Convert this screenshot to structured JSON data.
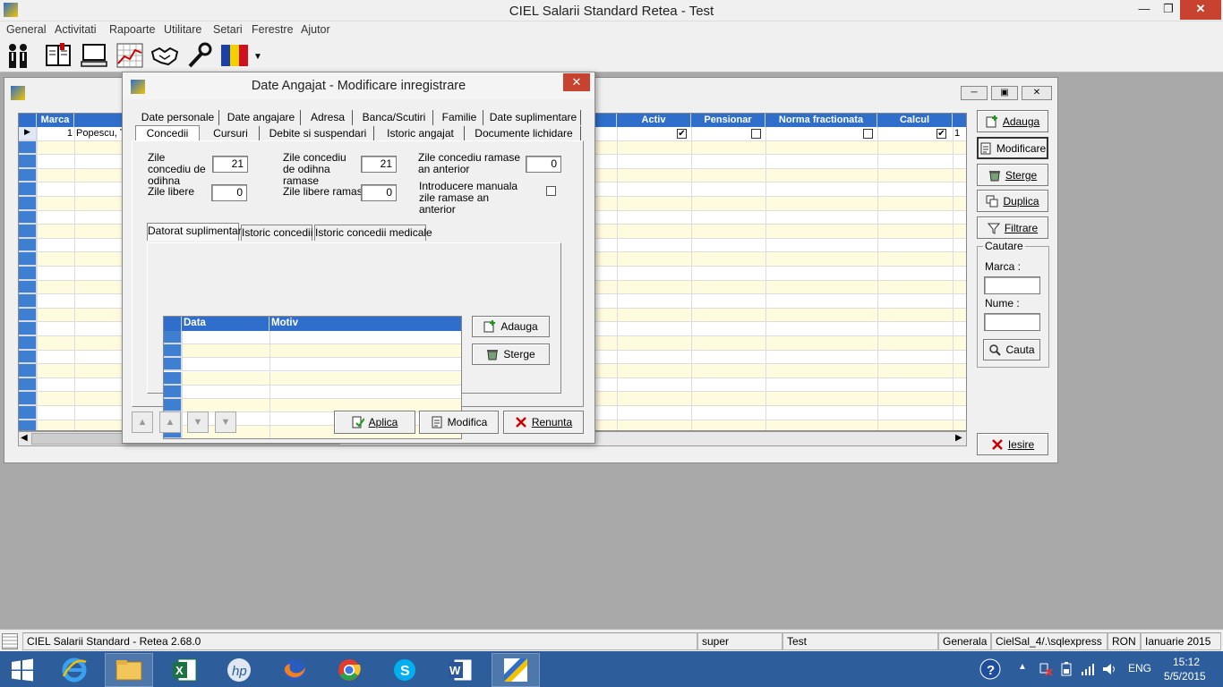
{
  "app": {
    "title": "CIEL Salarii Standard Retea - Test"
  },
  "menu": [
    "General",
    "Activitati",
    "Rapoarte",
    "Utilitare",
    "Setari",
    "Ferestre",
    "Ajutor"
  ],
  "employees": {
    "columns": {
      "marca": "Marca",
      "activ": "Activ",
      "pensionar": "Pensionar",
      "norma": "Norma fractionata",
      "calcul": "Calcul"
    },
    "row": {
      "marca": "1",
      "nume": "Popescu, T",
      "activ": true,
      "pensionar": false,
      "norma": false,
      "calcul": true,
      "extra": "1"
    },
    "buttons": {
      "adauga": "Adauga",
      "modificare": "Modificare",
      "sterge": "Sterge",
      "duplica": "Duplica",
      "filtrare": "Filtrare",
      "iesire": "Iesire"
    },
    "search": {
      "group": "Cautare",
      "marca_label": "Marca :",
      "nume_label": "Nume :",
      "marca_value": "",
      "nume_value": "",
      "button": "Cauta"
    }
  },
  "dialog": {
    "title": "Date Angajat - Modificare inregistrare",
    "tabs_row1": [
      "Date personale",
      "Date angajare",
      "Adresa",
      "Banca/Scutiri",
      "Familie",
      "Date suplimentare"
    ],
    "tabs_row2": [
      "Concedii",
      "Cursuri",
      "Debite si suspendari",
      "Istoric angajat",
      "Documente lichidare"
    ],
    "active_tab": "Concedii",
    "fields": {
      "zile_co_label": "Zile concediu de odihna",
      "zile_co_value": "21",
      "zile_co_ramase_label": "Zile concediu de odihna ramase",
      "zile_co_ramase_value": "21",
      "zile_co_an_ant_label": "Zile concediu ramase an anterior",
      "zile_co_an_ant_value": "0",
      "zile_libere_label": "Zile libere",
      "zile_libere_value": "0",
      "zile_libere_ramase_label": "Zile libere ramase",
      "zile_libere_ramase_value": "0",
      "introducere_manuala_label": "Introducere manuala zile ramase an anterior",
      "introducere_manuala_checked": false
    },
    "subtabs": [
      "Datorat suplimentar",
      "Istoric concedii",
      "Istoric concedii medicale"
    ],
    "active_subtab": "Datorat suplimentar",
    "subgrid": {
      "columns": [
        "Data",
        "Motiv"
      ]
    },
    "sub_buttons": {
      "adauga": "Adauga",
      "sterge": "Sterge"
    },
    "buttons": {
      "aplica": "Aplica",
      "modifica": "Modifica",
      "renunta": "Renunta"
    }
  },
  "status": {
    "app": "CIEL Salarii Standard - Retea 2.68.0",
    "user": "super",
    "company": "Test",
    "module": "Generala",
    "server": "CielSal_4/.\\sqlexpress",
    "currency": "RON",
    "period": "Ianuarie 2015"
  },
  "taskbar": {
    "lang": "ENG",
    "time": "15:12",
    "date": "5/5/2015"
  }
}
